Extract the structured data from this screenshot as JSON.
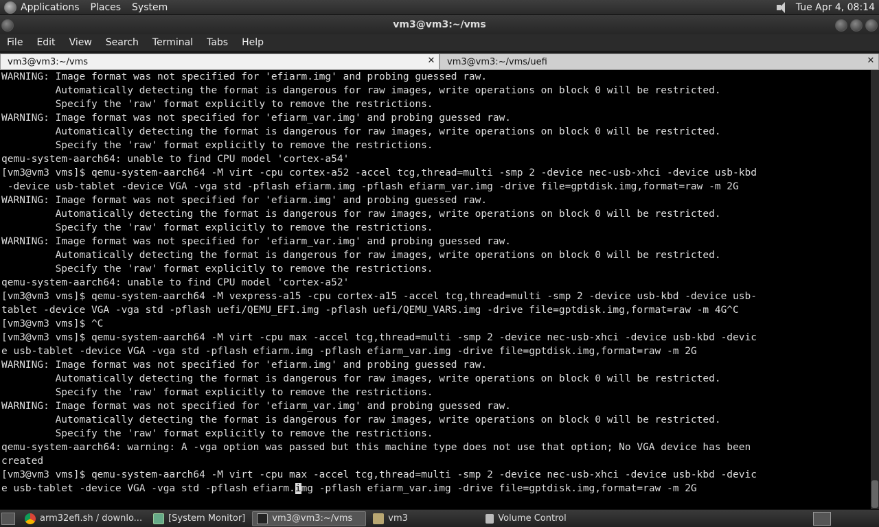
{
  "top_panel": {
    "menus": [
      "Applications",
      "Places",
      "System"
    ],
    "clock": "Tue Apr  4, 08:14"
  },
  "window": {
    "title": "vm3@vm3:~/vms"
  },
  "menubar": {
    "items": [
      "File",
      "Edit",
      "View",
      "Search",
      "Terminal",
      "Tabs",
      "Help"
    ]
  },
  "tabs": [
    {
      "label": "vm3@vm3:~/vms",
      "active": true
    },
    {
      "label": "vm3@vm3:~/vms/uefi",
      "active": false
    }
  ],
  "terminal": {
    "lines": [
      "WARNING: Image format was not specified for 'efiarm.img' and probing guessed raw.",
      "         Automatically detecting the format is dangerous for raw images, write operations on block 0 will be restricted.",
      "         Specify the 'raw' format explicitly to remove the restrictions.",
      "WARNING: Image format was not specified for 'efiarm_var.img' and probing guessed raw.",
      "         Automatically detecting the format is dangerous for raw images, write operations on block 0 will be restricted.",
      "         Specify the 'raw' format explicitly to remove the restrictions.",
      "qemu-system-aarch64: unable to find CPU model 'cortex-a54'",
      "[vm3@vm3 vms]$ qemu-system-aarch64 -M virt -cpu cortex-a52 -accel tcg,thread=multi -smp 2 -device nec-usb-xhci -device usb-kbd",
      " -device usb-tablet -device VGA -vga std -pflash efiarm.img -pflash efiarm_var.img -drive file=gptdisk.img,format=raw -m 2G",
      "WARNING: Image format was not specified for 'efiarm.img' and probing guessed raw.",
      "         Automatically detecting the format is dangerous for raw images, write operations on block 0 will be restricted.",
      "         Specify the 'raw' format explicitly to remove the restrictions.",
      "WARNING: Image format was not specified for 'efiarm_var.img' and probing guessed raw.",
      "         Automatically detecting the format is dangerous for raw images, write operations on block 0 will be restricted.",
      "         Specify the 'raw' format explicitly to remove the restrictions.",
      "qemu-system-aarch64: unable to find CPU model 'cortex-a52'",
      "[vm3@vm3 vms]$ qemu-system-aarch64 -M vexpress-a15 -cpu cortex-a15 -accel tcg,thread=multi -smp 2 -device usb-kbd -device usb-",
      "tablet -device VGA -vga std -pflash uefi/QEMU_EFI.img -pflash uefi/QEMU_VARS.img -drive file=gptdisk.img,format=raw -m 4G^C",
      "[vm3@vm3 vms]$ ^C",
      "[vm3@vm3 vms]$ qemu-system-aarch64 -M virt -cpu max -accel tcg,thread=multi -smp 2 -device nec-usb-xhci -device usb-kbd -devic",
      "e usb-tablet -device VGA -vga std -pflash efiarm.img -pflash efiarm_var.img -drive file=gptdisk.img,format=raw -m 2G",
      "WARNING: Image format was not specified for 'efiarm.img' and probing guessed raw.",
      "         Automatically detecting the format is dangerous for raw images, write operations on block 0 will be restricted.",
      "         Specify the 'raw' format explicitly to remove the restrictions.",
      "WARNING: Image format was not specified for 'efiarm_var.img' and probing guessed raw.",
      "         Automatically detecting the format is dangerous for raw images, write operations on block 0 will be restricted.",
      "         Specify the 'raw' format explicitly to remove the restrictions.",
      "qemu-system-aarch64: warning: A -vga option was passed but this machine type does not use that option; No VGA device has been",
      "created",
      "[vm3@vm3 vms]$ qemu-system-aarch64 -M virt -cpu max -accel tcg,thread=multi -smp 2 -device nec-usb-xhci -device usb-kbd -devic"
    ],
    "last_line_before_cursor": "e usb-tablet -device VGA -vga std -pflash efiarm.",
    "cursor_char": "i",
    "last_line_after_cursor": "mg -pflash efiarm_var.img -drive file=gptdisk.img,format=raw -m 2G"
  },
  "taskbar": {
    "tasks": [
      {
        "label": "arm32efi.sh / downlo...",
        "icon": "chrome-icon"
      },
      {
        "label": "[System Monitor]",
        "icon": "system-monitor-icon"
      },
      {
        "label": "vm3@vm3:~/vms",
        "icon": "terminal-icon",
        "active": true
      },
      {
        "label": "vm3",
        "icon": "folder-icon"
      },
      {
        "label": "Volume Control",
        "icon": "speaker-icon"
      }
    ]
  }
}
